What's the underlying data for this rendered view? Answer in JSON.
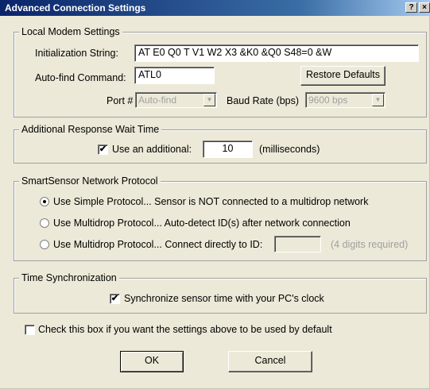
{
  "window": {
    "title": "Advanced Connection Settings",
    "help_button": "?",
    "close_button": "×"
  },
  "modem": {
    "group_label": "Local Modem Settings",
    "init_label": "Initialization String:",
    "init_value": "AT E0 Q0 T V1 W2 X3 &K0 &Q0 S48=0 &W",
    "autofind_label": "Auto-find Command:",
    "autofind_value": "ATL0",
    "restore_button": "Restore Defaults",
    "port_label": "Port #",
    "port_value": "Auto-find",
    "baud_label": "Baud Rate (bps)",
    "baud_value": "9600 bps"
  },
  "wait": {
    "group_label": "Additional Response Wait Time",
    "use_label": "Use an additional:",
    "use_checked": true,
    "value": "10",
    "unit": "(milliseconds)"
  },
  "protocol": {
    "group_label": "SmartSensor Network Protocol",
    "options": [
      {
        "label": "Use Simple Protocol... Sensor is NOT connected to a multidrop network",
        "selected": true
      },
      {
        "label": "Use Multidrop Protocol... Auto-detect ID(s) after network connection",
        "selected": false
      },
      {
        "label": "Use Multidrop Protocol... Connect directly to ID:",
        "selected": false
      }
    ],
    "id_value": "",
    "id_hint": "(4 digits required)"
  },
  "time_sync": {
    "group_label": "Time Synchronization",
    "sync_label": "Synchronize sensor time with your PC's clock",
    "sync_checked": true
  },
  "default_check": {
    "label": "Check this box if you want the settings above to be used by default",
    "checked": false
  },
  "buttons": {
    "ok": "OK",
    "cancel": "Cancel"
  },
  "icons": {
    "checkmark": "✔",
    "dropdown": "▼"
  }
}
